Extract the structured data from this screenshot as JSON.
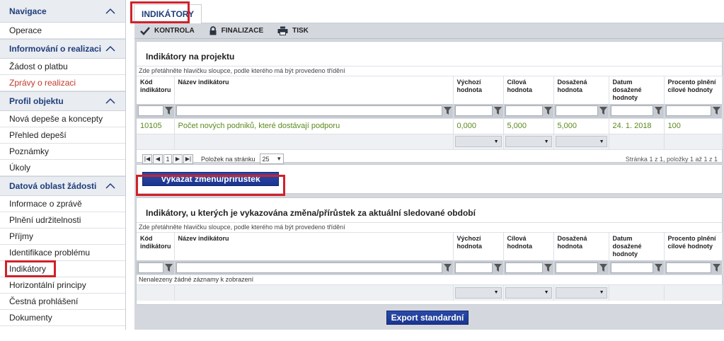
{
  "sidebar": {
    "sections": [
      {
        "title": "Navigace",
        "items": [
          "Operace"
        ]
      },
      {
        "title": "Informování o realizaci",
        "items": [
          "Žádost o platbu",
          "Zprávy o realizaci"
        ]
      },
      {
        "title": "Profil objektu",
        "items": [
          "Nová depeše a koncepty",
          "Přehled depeší",
          "Poznámky",
          "Úkoly"
        ]
      },
      {
        "title": "Datová oblast žádosti",
        "items": [
          "Informace o zprávě",
          "Plnění udržitelnosti",
          "Příjmy",
          "Identifikace problému",
          "Indikátory",
          "Horizontální principy",
          "Čestná prohlášení",
          "Dokumenty"
        ]
      }
    ],
    "active_item": "Indikátory",
    "link_item": "Zprávy o realizaci"
  },
  "tab": {
    "label": "INDIKÁTORY"
  },
  "toolbar": {
    "kontrola": "KONTROLA",
    "finalizace": "FINALIZACE",
    "tisk": "TISK"
  },
  "grid1": {
    "title": "Indikátory na projektu",
    "hint": "Zde přetáhněte hlavičku sloupce, podle kterého má být provedeno třídění",
    "columns": [
      "Kód indikátoru",
      "Název indikátoru",
      "Výchozí hodnota",
      "Cílová hodnota",
      "Dosažená hodnota",
      "Datum dosažené hodnoty",
      "Procento plnění cílové hodnoty"
    ],
    "rows": [
      [
        "10105",
        "Počet nových podniků, které dostávají podporu",
        "0,000",
        "5,000",
        "5,000",
        "24. 1. 2018",
        "100"
      ]
    ],
    "pager": {
      "current": "1",
      "per_page_label": "Položek na stránku",
      "per_page": "25",
      "info": "Stránka 1 z 1, položky 1 až 1 z 1"
    }
  },
  "action_button": {
    "label": "Vykázat změnu/přírůstek"
  },
  "grid2": {
    "title": "Indikátory, u kterých je vykazována změna/přírůstek za aktuální sledované období",
    "hint": "Zde přetáhněte hlavičku sloupce, podle kterého má být provedeno třídění",
    "columns": [
      "Kód indikátoru",
      "Název indikátoru",
      "Výchozí hodnota",
      "Cílová hodnota",
      "Dosažená hodnota",
      "Datum dosažené hodnoty",
      "Procento plnění cílové hodnoty"
    ],
    "empty": "Nenalezeny žádné záznamy k zobrazení"
  },
  "export_button": {
    "label": "Export standardní"
  },
  "colors": {
    "accent": "#1f3d7a",
    "highlight": "#d0212a",
    "value_green": "#5b8a1e",
    "button_blue": "#1a3590"
  }
}
